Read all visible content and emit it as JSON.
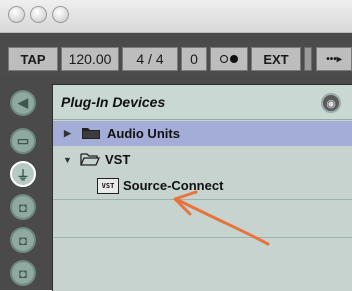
{
  "transport": {
    "tap": "TAP",
    "tempo": "120.00",
    "time_signature": "4 / 4",
    "groove": "0",
    "ext": "EXT"
  },
  "browser": {
    "title": "Plug-In Devices",
    "items": [
      {
        "label": "Audio Units",
        "expanded": false,
        "selected": true
      },
      {
        "label": "VST",
        "expanded": true,
        "selected": false
      },
      {
        "label": "Source-Connect",
        "badge": "VST",
        "selected": false
      }
    ]
  },
  "colors": {
    "selection": "#a4add8",
    "browser_bg": "#c6d3cf",
    "annotation_arrow": "#e8743b"
  }
}
